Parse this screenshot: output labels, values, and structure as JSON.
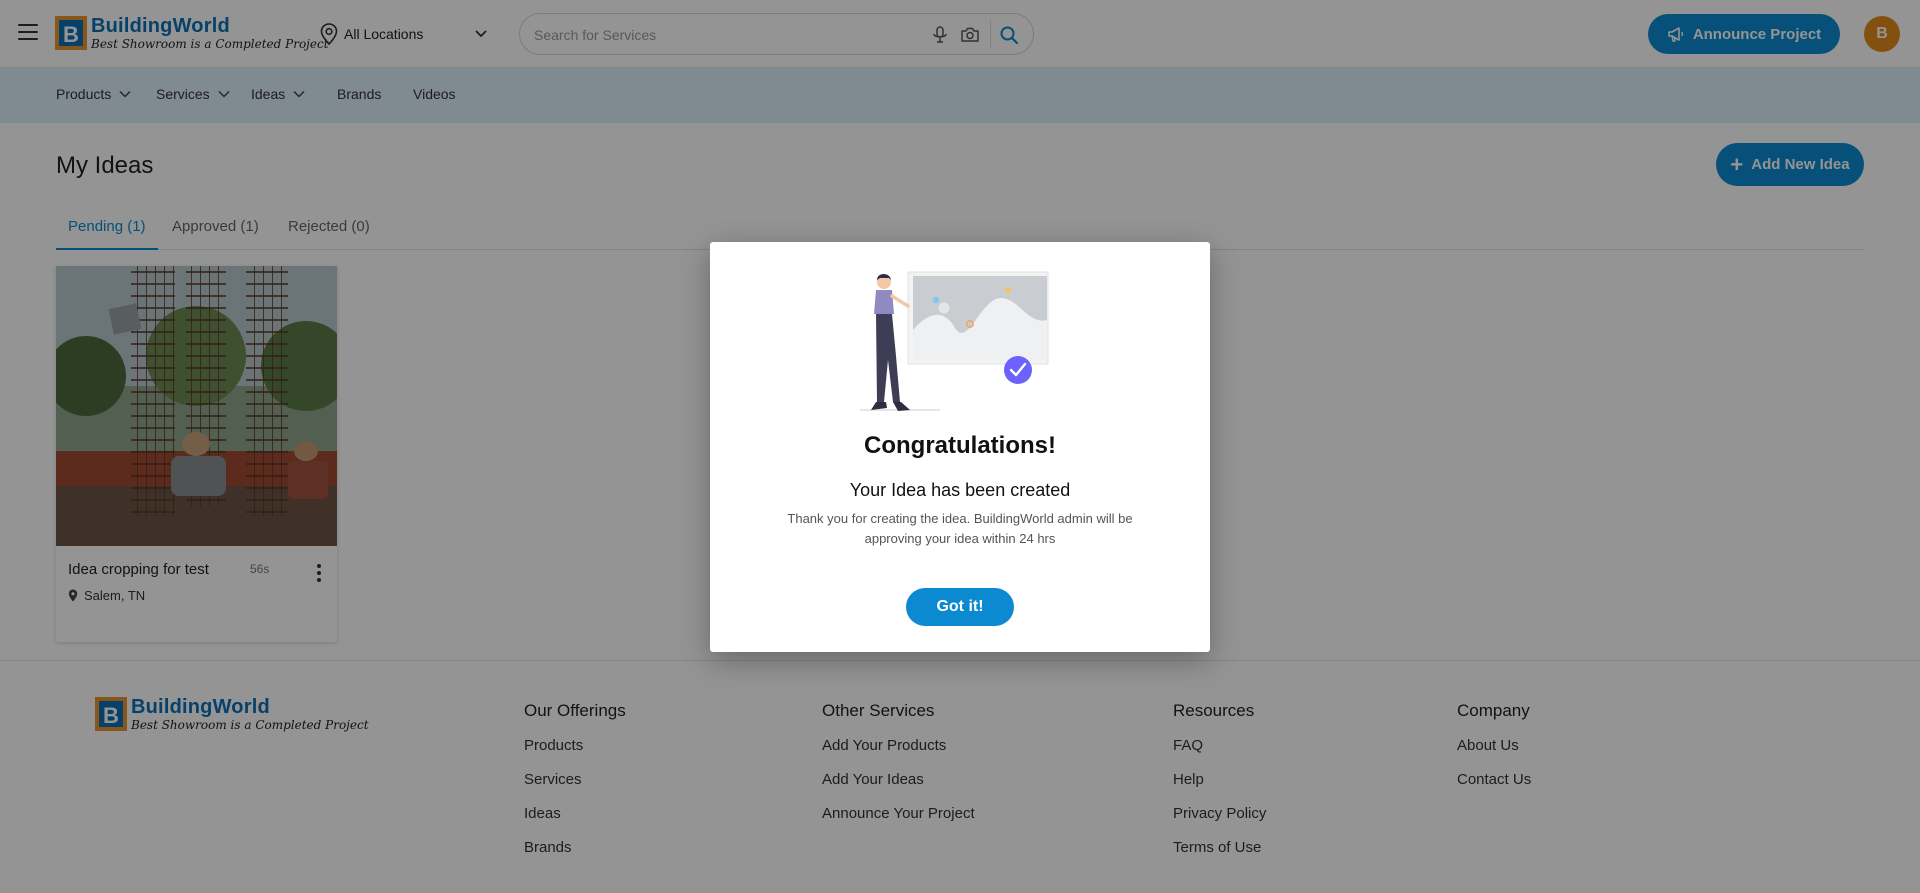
{
  "header": {
    "brand_name": "BuildingWorld",
    "brand_tagline": "Best Showroom is a Completed Project",
    "location_label": "All Locations",
    "search_placeholder": "Search for Services",
    "announce_label": "Announce Project",
    "avatar_initial": "B",
    "accent_color": "#0b8ad1"
  },
  "nav": {
    "items": [
      {
        "label": "Products",
        "has_dropdown": true
      },
      {
        "label": "Services",
        "has_dropdown": true
      },
      {
        "label": "Ideas",
        "has_dropdown": true
      },
      {
        "label": "Brands",
        "has_dropdown": false
      },
      {
        "label": "Videos",
        "has_dropdown": false
      }
    ]
  },
  "main": {
    "title": "My Ideas",
    "add_button_label": "Add New Idea",
    "tabs": [
      {
        "label": "Pending (1)",
        "active": true
      },
      {
        "label": "Approved (1)",
        "active": false
      },
      {
        "label": "Rejected (0)",
        "active": false
      }
    ],
    "ideas": [
      {
        "title": "Idea cropping for test",
        "time": "56s",
        "location": "Salem, TN"
      }
    ]
  },
  "footer": {
    "brand_name": "BuildingWorld",
    "brand_tagline": "Best Showroom is a Completed Project",
    "columns": [
      {
        "heading": "Our Offerings",
        "links": [
          "Products",
          "Services",
          "Ideas",
          "Brands"
        ]
      },
      {
        "heading": "Other Services",
        "links": [
          "Add Your Products",
          "Add Your Ideas",
          "Announce Your Project"
        ]
      },
      {
        "heading": "Resources",
        "links": [
          "FAQ",
          "Help",
          "Privacy Policy",
          "Terms of Use"
        ]
      },
      {
        "heading": "Company",
        "links": [
          "About Us",
          "Contact Us"
        ]
      }
    ]
  },
  "modal": {
    "title": "Congratulations!",
    "subtitle": "Your Idea has been created",
    "message": "Thank you for creating the idea. BuildingWorld admin will be approving your idea within 24 hrs",
    "button_label": "Got it!"
  }
}
